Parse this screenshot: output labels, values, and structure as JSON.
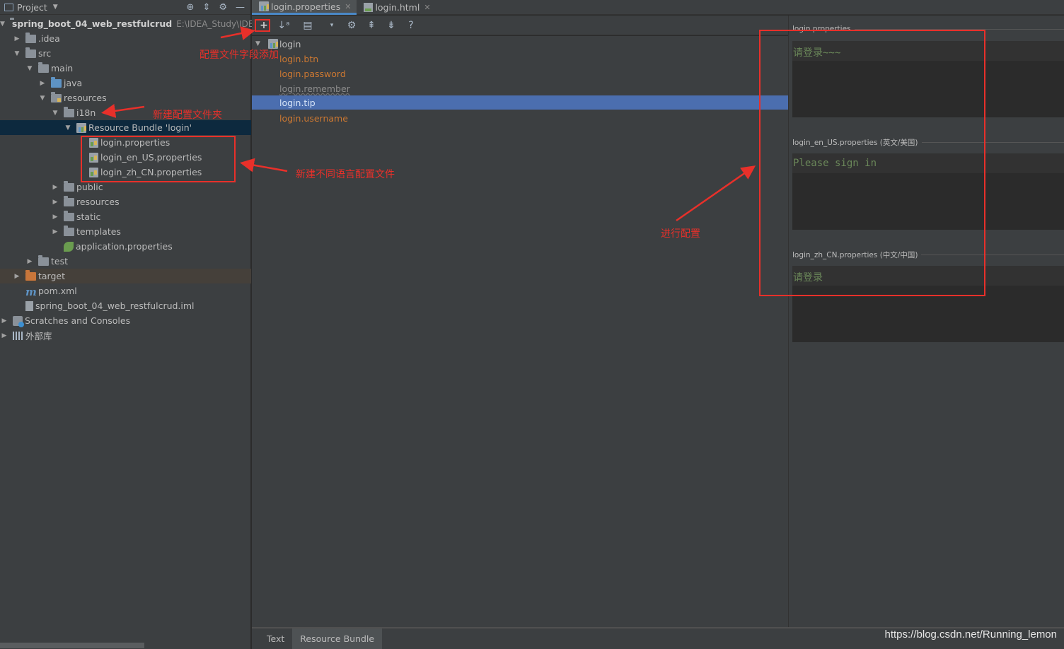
{
  "project_panel": {
    "title": "Project",
    "tree": [
      {
        "label": "spring_boot_04_web_restfulcrud",
        "path": "E:\\IDEA_Study\\IDEA",
        "bold": true
      },
      {
        "label": ".idea"
      },
      {
        "label": "src"
      },
      {
        "label": "main"
      },
      {
        "label": "java"
      },
      {
        "label": "resources"
      },
      {
        "label": "i18n"
      },
      {
        "label": "Resource Bundle 'login'"
      },
      {
        "label": "login.properties"
      },
      {
        "label": "login_en_US.properties"
      },
      {
        "label": "login_zh_CN.properties"
      },
      {
        "label": "public"
      },
      {
        "label": "resources"
      },
      {
        "label": "static"
      },
      {
        "label": "templates"
      },
      {
        "label": "application.properties"
      },
      {
        "label": "test"
      },
      {
        "label": "target"
      },
      {
        "label": "pom.xml"
      },
      {
        "label": "spring_boot_04_web_restfulcrud.iml"
      },
      {
        "label": "Scratches and Consoles"
      },
      {
        "label": "外部库"
      }
    ]
  },
  "editor_tabs": [
    {
      "label": "login.properties",
      "active": true
    },
    {
      "label": "login.html",
      "active": false
    }
  ],
  "bundle_editor": {
    "toolbar": {
      "add": "+",
      "sort": "↓ᵃ",
      "help": "?"
    },
    "root": "login",
    "keys": [
      "login.btn",
      "login.password",
      "login.remember",
      "login.tip",
      "login.username"
    ],
    "selected_key": "login.tip",
    "values": [
      {
        "file": "login.properties",
        "value": "请登录~~~"
      },
      {
        "file": "login_en_US.properties (英文/美国)",
        "value": "Please sign in"
      },
      {
        "file": "login_zh_CN.properties (中文/中国)",
        "value": "请登录"
      }
    ]
  },
  "bottom_tabs": [
    {
      "label": "Text",
      "active": false
    },
    {
      "label": "Resource Bundle",
      "active": true
    }
  ],
  "watermark": "https://blog.csdn.net/Running_lemon",
  "annotations": {
    "add_field": "配置文件字段添加",
    "new_folder": "新建配置文件夹",
    "new_lang_files": "新建不同语言配置文件",
    "configure": "进行配置"
  },
  "colors": {
    "key_orange": "#cc7832",
    "value_green": "#6a8759",
    "selection_blue": "#4b6eaf",
    "annotation_red": "#e8302a"
  }
}
